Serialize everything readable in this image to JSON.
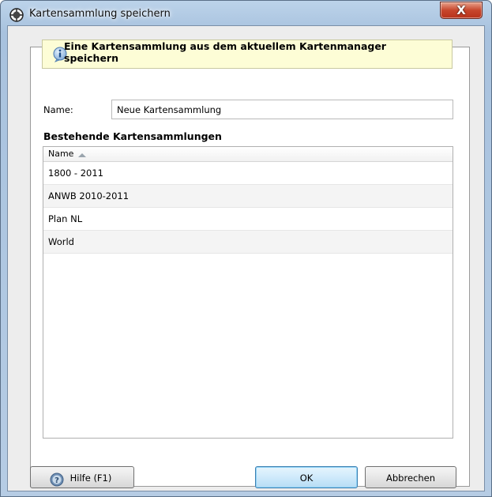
{
  "window": {
    "title": "Kartensammlung speichern",
    "close_label": "X"
  },
  "info": {
    "text": "Eine Kartensammlung aus dem aktuellem Kartenmanager speichern"
  },
  "name_field": {
    "label": "Name:",
    "value": "Neue Kartensammlung"
  },
  "collections": {
    "title": "Bestehende Kartensammlungen",
    "column_header": "Name",
    "sort": "ascending",
    "rows": [
      "1800 - 2011",
      "ANWB 2010-2011",
      "Plan NL",
      "World"
    ]
  },
  "buttons": {
    "help": "Hilfe (F1)",
    "ok": "OK",
    "cancel": "Abbrechen"
  }
}
